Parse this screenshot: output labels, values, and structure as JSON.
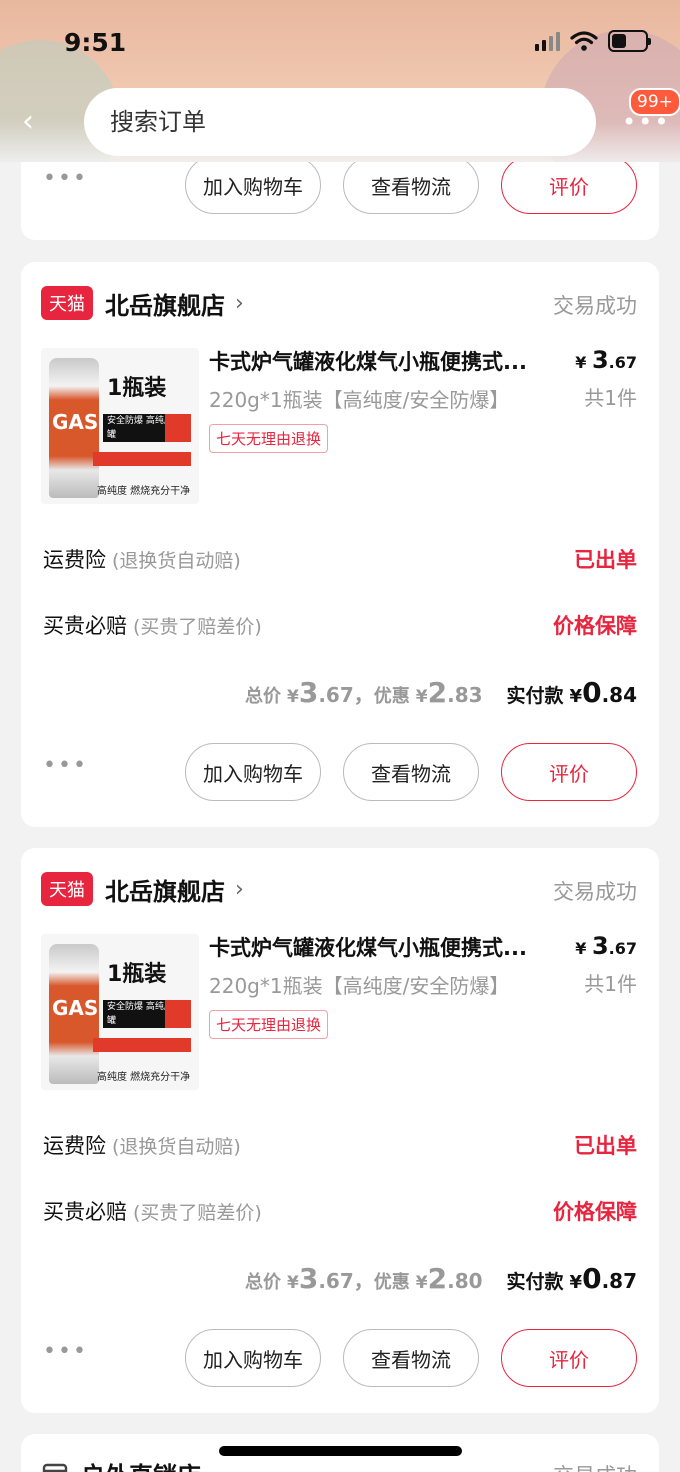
{
  "status_bar": {
    "time": "9:51"
  },
  "header": {
    "search_placeholder": "搜索订单",
    "back_glyph": "‹",
    "more_glyph": "•••",
    "notification_count": "99+"
  },
  "orders_top": {
    "actions": {
      "more": "•••",
      "add_to_cart": "加入购物车",
      "view_logistics": "查看物流",
      "review": "评价"
    }
  },
  "orders": [
    {
      "store_badge": "天猫",
      "store_name": "北岳旗舰店",
      "store_chevron": "›",
      "status": "交易成功",
      "product": {
        "title": "卡式炉气罐液化煤气小瓶便携式...",
        "spec": "220g*1瓶装【高纯度/安全防爆】",
        "return_policy": "七天无理由退换",
        "price_currency": "¥",
        "price_int": "3",
        "price_dec": ".67",
        "quantity": "共1件",
        "image_text": {
          "pack": "1瓶装",
          "tag": "安全防爆 高纯度气罐",
          "gas": "GAS",
          "foot": "高纯度 燃烧充分干净"
        }
      },
      "shipping_insurance": {
        "label": "运费险",
        "note": "(退换货自动赔)",
        "value": "已出单"
      },
      "price_protection": {
        "label": "买贵必赔",
        "note": "(买贵了赔差价)",
        "value": "价格保障"
      },
      "totals": {
        "total_label": "总价",
        "currency": "¥",
        "total_int": "3",
        "total_dec": ".67，",
        "discount_label": "优惠",
        "discount_int": "2",
        "discount_dec": ".83",
        "paid_label": "实付款",
        "paid_int": "0",
        "paid_dec": ".84"
      },
      "actions": {
        "more": "•••",
        "add_to_cart": "加入购物车",
        "view_logistics": "查看物流",
        "review": "评价"
      }
    },
    {
      "store_badge": "天猫",
      "store_name": "北岳旗舰店",
      "store_chevron": "›",
      "status": "交易成功",
      "product": {
        "title": "卡式炉气罐液化煤气小瓶便携式...",
        "spec": "220g*1瓶装【高纯度/安全防爆】",
        "return_policy": "七天无理由退换",
        "price_currency": "¥",
        "price_int": "3",
        "price_dec": ".67",
        "quantity": "共1件",
        "image_text": {
          "pack": "1瓶装",
          "tag": "安全防爆 高纯度气罐",
          "gas": "GAS",
          "foot": "高纯度 燃烧充分干净"
        }
      },
      "shipping_insurance": {
        "label": "运费险",
        "note": "(退换货自动赔)",
        "value": "已出单"
      },
      "price_protection": {
        "label": "买贵必赔",
        "note": "(买贵了赔差价)",
        "value": "价格保障"
      },
      "totals": {
        "total_label": "总价",
        "currency": "¥",
        "total_int": "3",
        "total_dec": ".67，",
        "discount_label": "优惠",
        "discount_int": "2",
        "discount_dec": ".80",
        "paid_label": "实付款",
        "paid_int": "0",
        "paid_dec": ".87"
      },
      "actions": {
        "more": "•••",
        "add_to_cart": "加入购物车",
        "view_logistics": "查看物流",
        "review": "评价"
      }
    }
  ],
  "orders_bottom": {
    "store_name": "户外直销店",
    "status": "交易成功"
  },
  "colors": {
    "accent_red": "#e8253f",
    "muted_text": "#999999",
    "page_bg": "#f2f2f2"
  }
}
